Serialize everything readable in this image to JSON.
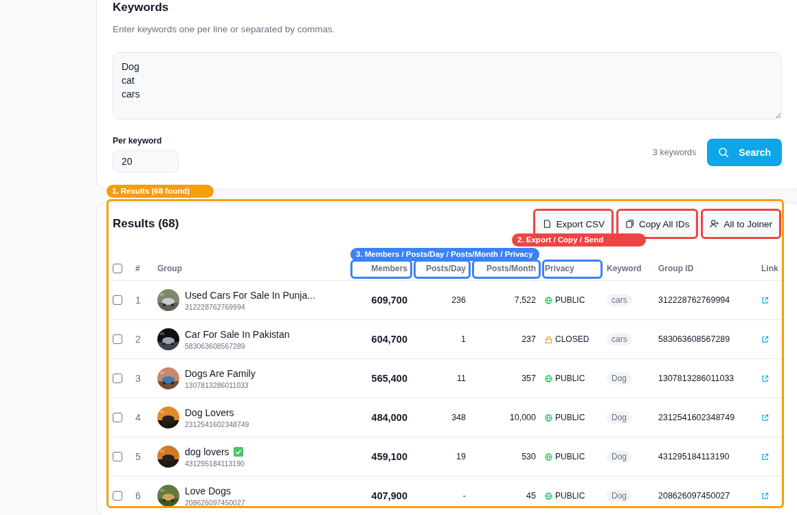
{
  "keywords": {
    "title": "Keywords",
    "hint": "Enter keywords one per line or separated by commas.",
    "value": "Dog\ncat\ncars",
    "per_keyword_label": "Per keyword",
    "per_keyword_value": "20",
    "count": "3 keywords",
    "search_button": "Search"
  },
  "results": {
    "title": "Results (68)",
    "buttons": [
      {
        "label": "Export CSV",
        "kind": "export"
      },
      {
        "label": "Copy All IDs",
        "kind": "copy"
      },
      {
        "label": "All to Joiner",
        "kind": "joiner"
      }
    ],
    "select_all_checked": false,
    "columns": [
      "#",
      "Group",
      "Members",
      "Posts/Day",
      "Posts/Month",
      "Privacy",
      "Keyword",
      "Group ID",
      "Link"
    ],
    "rows": [
      {
        "checked": false,
        "num": "1",
        "name": "Used Cars For Sale In Punja...",
        "sub_id": "312228762769994",
        "verified": false,
        "members": "609,700",
        "posts_day": "236",
        "posts_month": "7,522",
        "privacy": {
          "kind": "public",
          "label": "PUBLIC"
        },
        "keyword": "cars",
        "group_id": "312228762769994"
      },
      {
        "checked": false,
        "num": "2",
        "name": "Car For Sale In Pakistan",
        "sub_id": "583063608567289",
        "verified": false,
        "members": "604,700",
        "posts_day": "1",
        "posts_month": "237",
        "privacy": {
          "kind": "closed",
          "label": "CLOSED"
        },
        "keyword": "cars",
        "group_id": "583063608567289"
      },
      {
        "checked": false,
        "num": "3",
        "name": "Dogs Are Family",
        "sub_id": "1307813286011033",
        "verified": false,
        "members": "565,400",
        "posts_day": "11",
        "posts_month": "357",
        "privacy": {
          "kind": "public",
          "label": "PUBLIC"
        },
        "keyword": "Dog",
        "group_id": "1307813286011033"
      },
      {
        "checked": false,
        "num": "4",
        "name": "Dog Lovers",
        "sub_id": "2312541602348749",
        "verified": false,
        "members": "484,000",
        "posts_day": "348",
        "posts_month": "10,000",
        "privacy": {
          "kind": "public",
          "label": "PUBLIC"
        },
        "keyword": "Dog",
        "group_id": "2312541602348749"
      },
      {
        "checked": false,
        "num": "5",
        "name": "dog lovers",
        "sub_id": "431295184113190",
        "verified": true,
        "members": "459,100",
        "posts_day": "19",
        "posts_month": "530",
        "privacy": {
          "kind": "public",
          "label": "PUBLIC"
        },
        "keyword": "Dog",
        "group_id": "431295184113190"
      },
      {
        "checked": false,
        "num": "6",
        "name": "Love Dogs",
        "sub_id": "208626097450027",
        "verified": false,
        "members": "407,900",
        "posts_day": "-",
        "posts_month": "45",
        "privacy": {
          "kind": "public",
          "label": "PUBLIC"
        },
        "keyword": "Dog",
        "group_id": "208626097450027"
      }
    ]
  },
  "annotations": [
    {
      "label": "1. Results (68 found)",
      "color": "#f59e0b"
    },
    {
      "label": "2. Export / Copy / Send",
      "color": "#ef4444"
    },
    {
      "label": "3. Members / Posts/Day / Posts/Month / Privacy",
      "color": "#3b82f6"
    }
  ]
}
